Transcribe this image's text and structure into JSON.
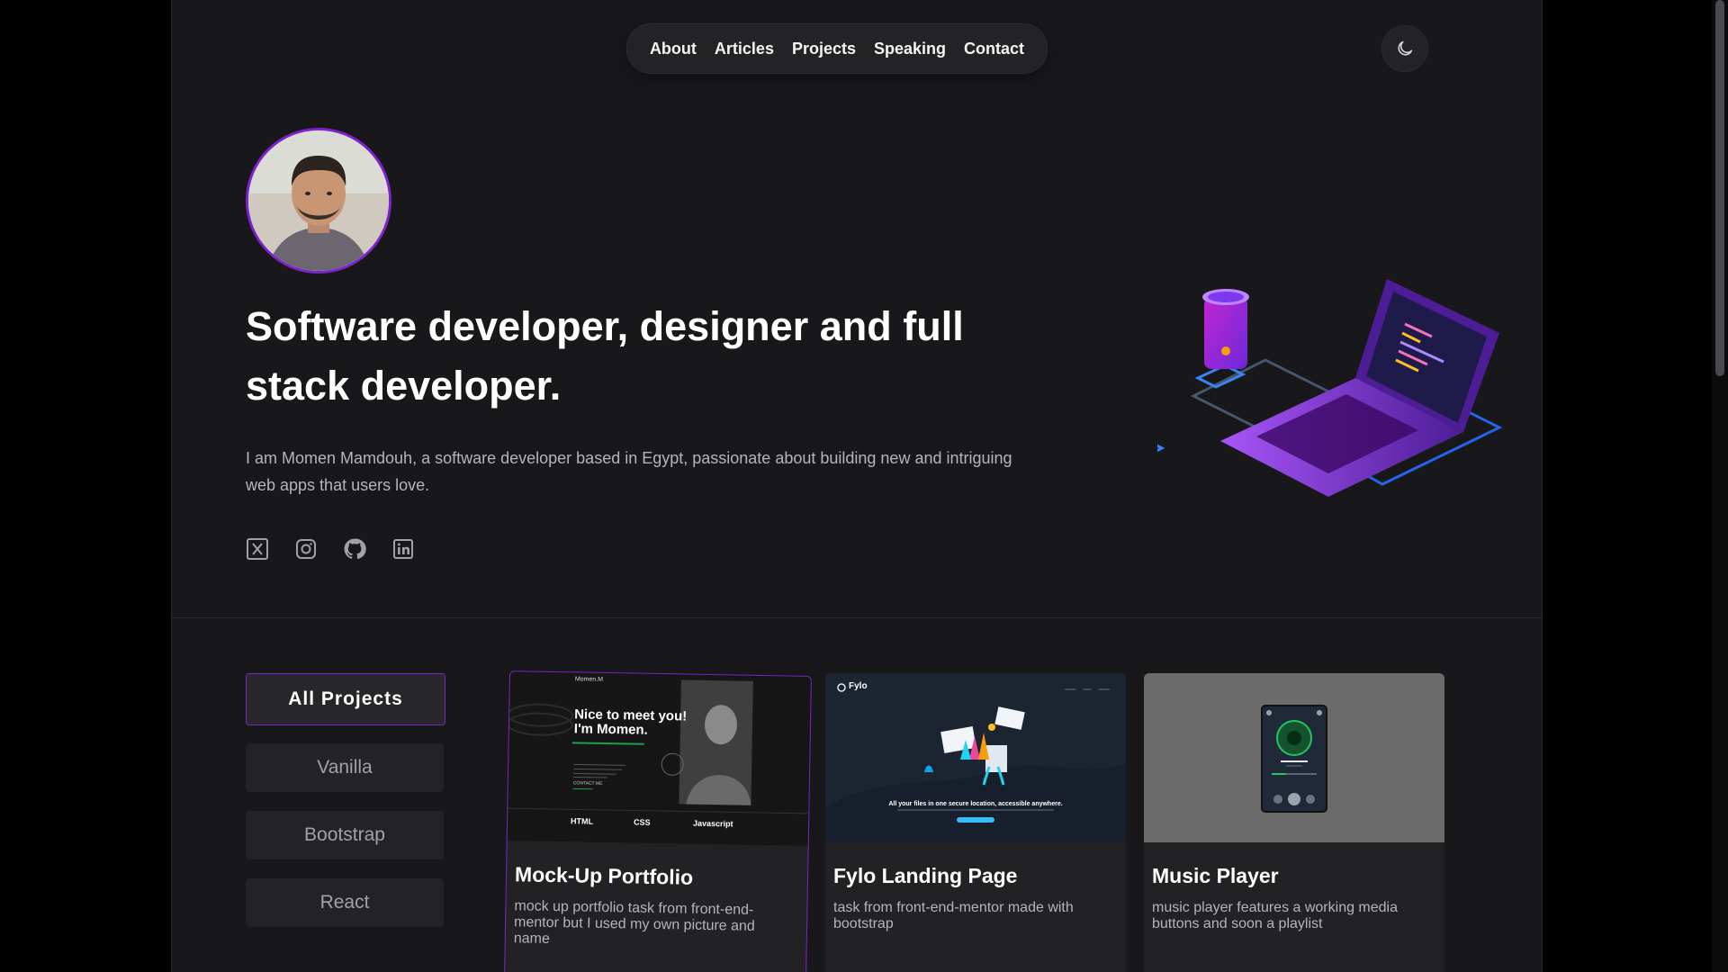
{
  "nav": {
    "items": [
      "About",
      "Articles",
      "Projects",
      "Speaking",
      "Contact"
    ]
  },
  "theme_toggle": {
    "icon": "moon-icon"
  },
  "hero": {
    "title": "Software developer, designer and full stack developer.",
    "description": "I am Momen Mamdouh, a software developer based in Egypt, passionate about building new and intriguing web apps that users love.",
    "socials": [
      "x-icon",
      "instagram-icon",
      "github-icon",
      "linkedin-icon"
    ]
  },
  "filters": {
    "items": [
      "All Projects",
      "Vanilla",
      "Bootstrap",
      "React"
    ],
    "active": "All Projects"
  },
  "projects": [
    {
      "title": "Mock-Up Portfolio",
      "description": "mock up portfolio task from front-end-mentor but I used my own picture and name",
      "thumb": {
        "brand": "Momen.M",
        "headline_1": "Nice to meet you!",
        "headline_2": "I'm Momen.",
        "cta": "CONTACT ME",
        "skills": [
          "HTML",
          "CSS",
          "Javascript"
        ]
      }
    },
    {
      "title": "Fylo Landing Page",
      "description": "task from front-end-mentor made with bootstrap",
      "thumb": {
        "brand": "Fylo",
        "headline": "All your files in one secure location, accessible anywhere."
      }
    },
    {
      "title": "Music Player",
      "description": "music player features a working media buttons and soon a playlist",
      "thumb": {}
    }
  ],
  "colors": {
    "accent": "#7e22ce",
    "background": "#18181b",
    "surface": "#232326"
  }
}
